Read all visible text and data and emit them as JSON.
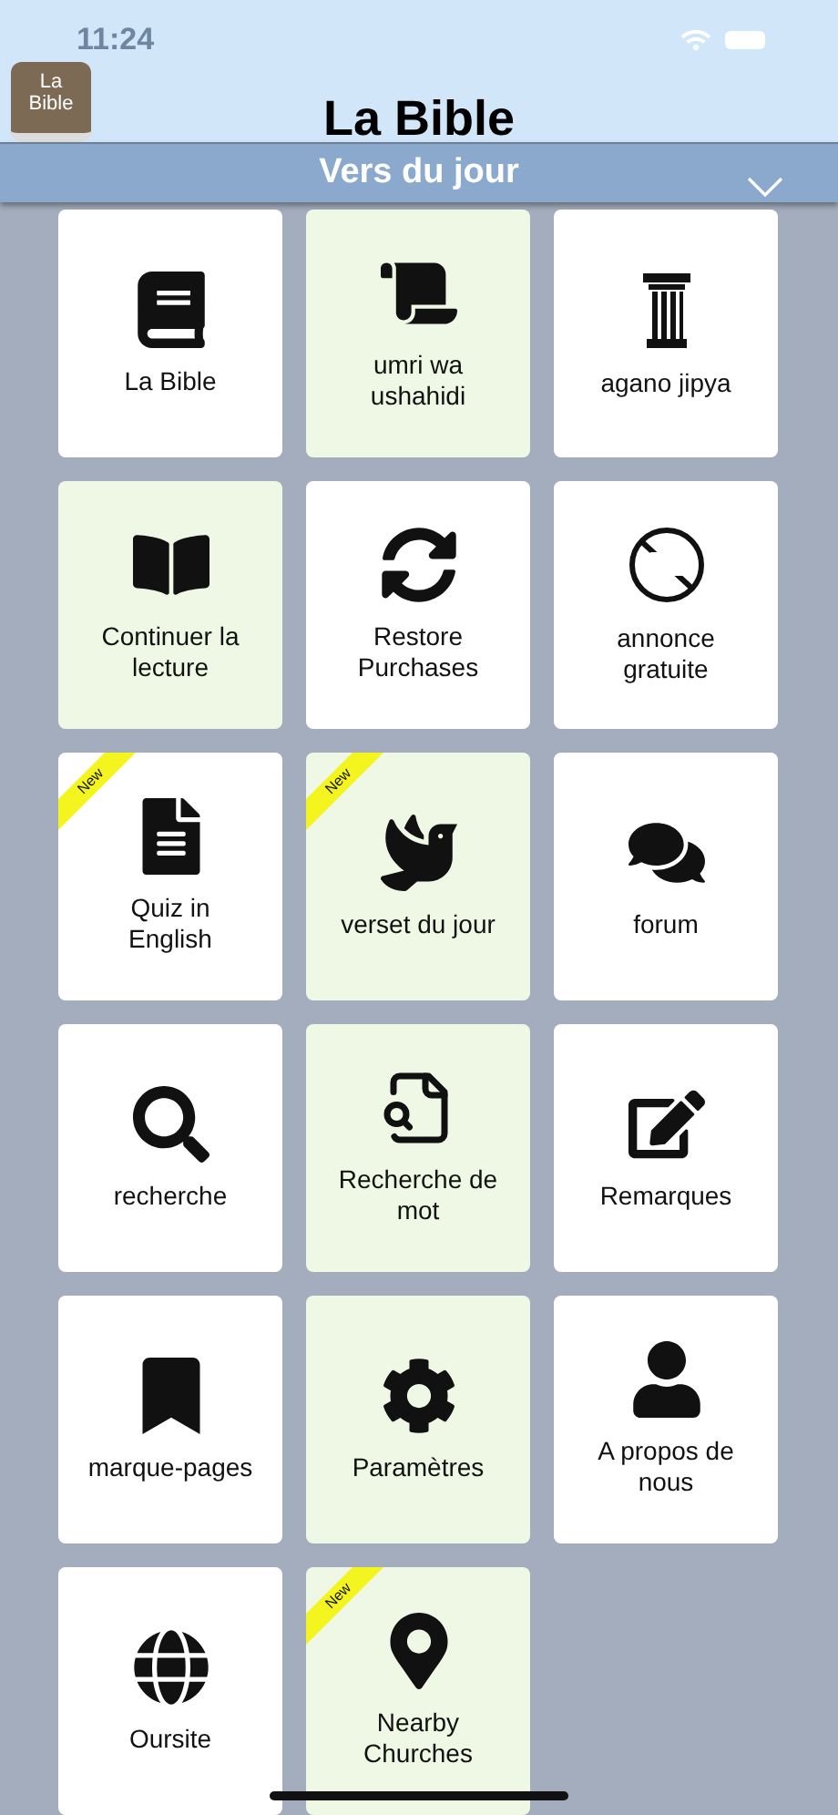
{
  "status_bar": {
    "time": "11:24"
  },
  "header": {
    "app_icon_text": "La Bible",
    "title": "La Bible"
  },
  "banner": {
    "title": "Vers du jour",
    "expanded": false
  },
  "tiles": [
    {
      "label": "La  Bible",
      "highlighted": false
    },
    {
      "label": "umri  wa ushahidi",
      "highlighted": true
    },
    {
      "label": "agano  jipya",
      "highlighted": false
    },
    {
      "label": "Continuer la  lecture",
      "highlighted": true
    },
    {
      "label": "Restore Purchases",
      "highlighted": false
    },
    {
      "label": "annonce gratuite",
      "highlighted": false
    },
    {
      "label": "Quiz in English",
      "highlighted": false,
      "badge": "New"
    },
    {
      "label": "verset du jour",
      "highlighted": true,
      "badge": "New"
    },
    {
      "label": "forum",
      "highlighted": false
    },
    {
      "label": "recherche",
      "highlighted": false
    },
    {
      "label": "Recherche de mot",
      "highlighted": true
    },
    {
      "label": "Remarques",
      "highlighted": false
    },
    {
      "label": "marque-pages",
      "highlighted": false
    },
    {
      "label": "Paramètres",
      "highlighted": true
    },
    {
      "label": "A propos de nous",
      "highlighted": false
    },
    {
      "label": "Oursite",
      "highlighted": false
    },
    {
      "label": "Nearby Churches",
      "highlighted": true,
      "badge": "New"
    }
  ]
}
